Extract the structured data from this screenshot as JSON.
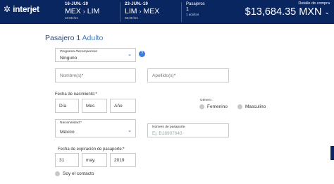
{
  "header": {
    "brand": "interjet",
    "leg1": {
      "date": "16-JUN.-19",
      "from": "MEX",
      "to": "LIM",
      "time": "10:05 hrs"
    },
    "leg2": {
      "date": "23-JUN.-19",
      "from": "LIM",
      "to": "MEX",
      "time": "06:38 hrs"
    },
    "passengers": {
      "title": "Pasajeros",
      "count": "1",
      "sub": "1 adultos"
    },
    "detail": {
      "label": "Detalle de compra",
      "amount": "$13,684.35",
      "currency": "MXN"
    },
    "route_arrow": "›",
    "caret": "⌄"
  },
  "form": {
    "title_main": "Pasajero 1",
    "title_sub": " Adulto",
    "program": {
      "label": "Programa Recompensas",
      "value": "Ninguno"
    },
    "help": "?",
    "first_name": {
      "placeholder": "Nombre(s)",
      "req": "*"
    },
    "last_name": {
      "placeholder": "Apellido(s)",
      "req": "*"
    },
    "birth_label": "Fecha de nacimiento:*",
    "birth": {
      "day": "Día",
      "month": "Mes",
      "year": "Año"
    },
    "gender": {
      "label": "Género",
      "female": "Femenino",
      "male": "Masculino"
    },
    "nationality": {
      "label": "Nacionalidad:*",
      "value": "México"
    },
    "passport": {
      "label": "Número de pasaporte",
      "placeholder": "Ej. B18907643"
    },
    "passport_exp": {
      "label": "Fecha de expiración de pasaporte:*",
      "day": "31",
      "month": "may.",
      "year": "2019"
    },
    "contact": "Soy el contacto"
  }
}
